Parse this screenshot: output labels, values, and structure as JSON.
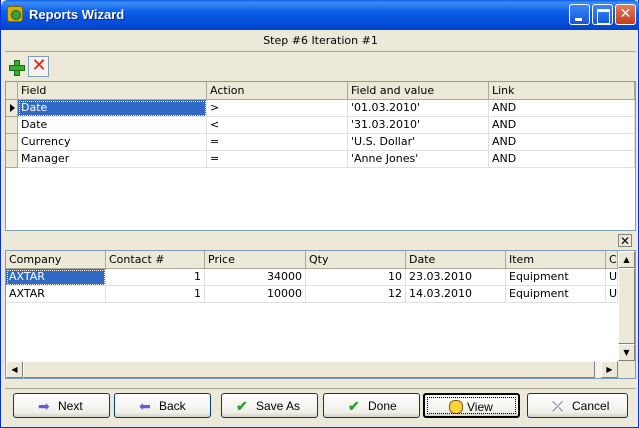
{
  "window": {
    "title": "Reports Wizard"
  },
  "step": {
    "label": "Step #6  Iteration #1"
  },
  "criteria": {
    "columns": [
      "Field",
      "Action",
      "Field and value",
      "Link"
    ],
    "rows": [
      [
        "Date",
        ">",
        "'01.03.2010'",
        "AND"
      ],
      [
        "Date",
        "<",
        "'31.03.2010'",
        "AND"
      ],
      [
        "Currency",
        "=",
        "'U.S. Dollar'",
        "AND"
      ],
      [
        "Manager",
        "=",
        "'Anne Jones'",
        "AND"
      ]
    ]
  },
  "results": {
    "columns": [
      "Company",
      "Contact #",
      "Price",
      "Qty",
      "Date",
      "Item",
      "C"
    ],
    "rows": [
      [
        "AXTAR",
        "1",
        "34000",
        "10",
        "23.03.2010",
        "Equipment",
        "U"
      ],
      [
        "AXTAR",
        "1",
        "10000",
        "12",
        "14.03.2010",
        "Equipment",
        "U"
      ]
    ]
  },
  "buttons": {
    "next": "Next",
    "back": "Back",
    "save_as": "Save As",
    "done": "Done",
    "view": "View",
    "cancel": "Cancel"
  },
  "icons": {
    "add": "plus-icon",
    "delete": "cross-icon",
    "close_panel": "close-icon"
  },
  "colors": {
    "selection": "#316ac5",
    "titlebar": "#0a5ee8"
  }
}
